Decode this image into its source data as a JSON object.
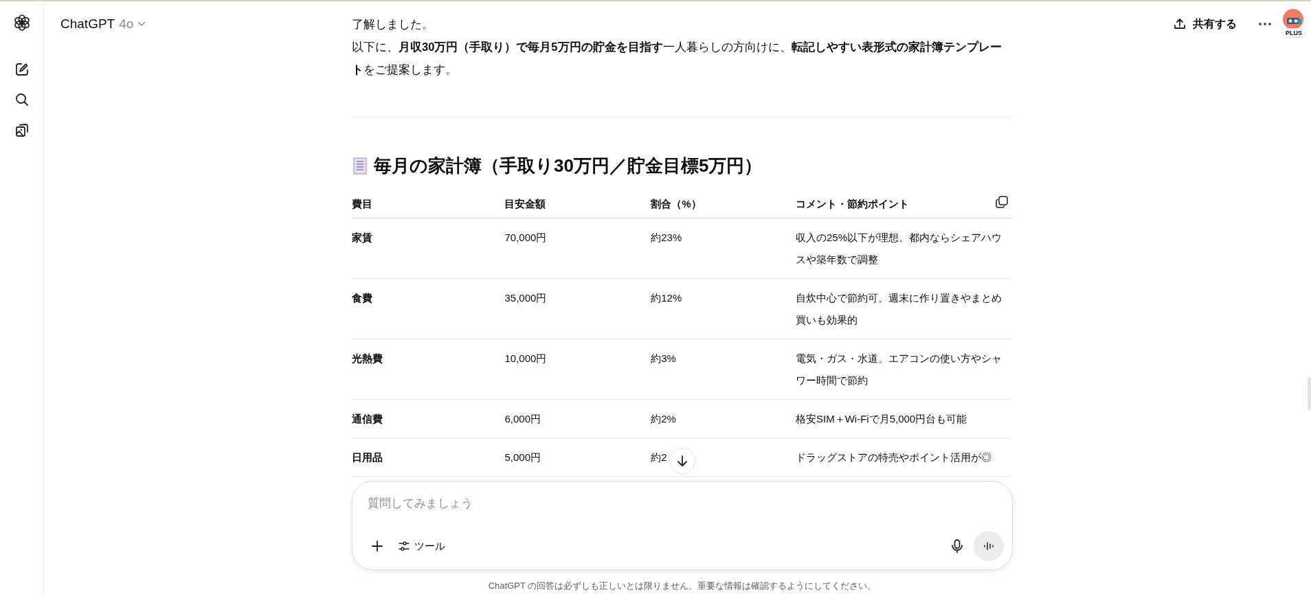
{
  "header": {
    "title": "ChatGPT",
    "model": "4o",
    "share_label": "共有する",
    "plan_badge": "PLUS"
  },
  "message": {
    "paragraphs": [
      "了解しました。",
      "以下に、**月収30万円（手取り）で毎月5万円の貯金を目指す**一人暮らしの方向けに、**転記しやすい表形式の家計簿テンプレート**をご提案します。"
    ],
    "heading": "毎月の家計簿（手取り30万円／貯金目標5万円）",
    "table": {
      "columns": [
        "費目",
        "目安金額",
        "割合（%）",
        "コメント・節約ポイント"
      ],
      "rows": [
        [
          "家賃",
          "70,000円",
          "約23%",
          "収入の25%以下が理想。都内ならシェアハウスや築年数で調整"
        ],
        [
          "食費",
          "35,000円",
          "約12%",
          "自炊中心で節約可。週末に作り置きやまとめ買いも効果的"
        ],
        [
          "光熱費",
          "10,000円",
          "約3%",
          "電気・ガス・水道。エアコンの使い方やシャワー時間で節約"
        ],
        [
          "通信費",
          "6,000円",
          "約2%",
          "格安SIM＋Wi-Fiで月5,000円台も可能"
        ],
        [
          "日用品",
          "5,000円",
          "約2",
          "ドラッグストアの特売やポイント活用が◎"
        ]
      ]
    }
  },
  "composer": {
    "placeholder": "質問してみましょう",
    "tools_label": "ツール"
  },
  "disclaimer": "ChatGPT の回答は必ずしも正しいとは限りません。重要な情報は確認するようにしてください。"
}
